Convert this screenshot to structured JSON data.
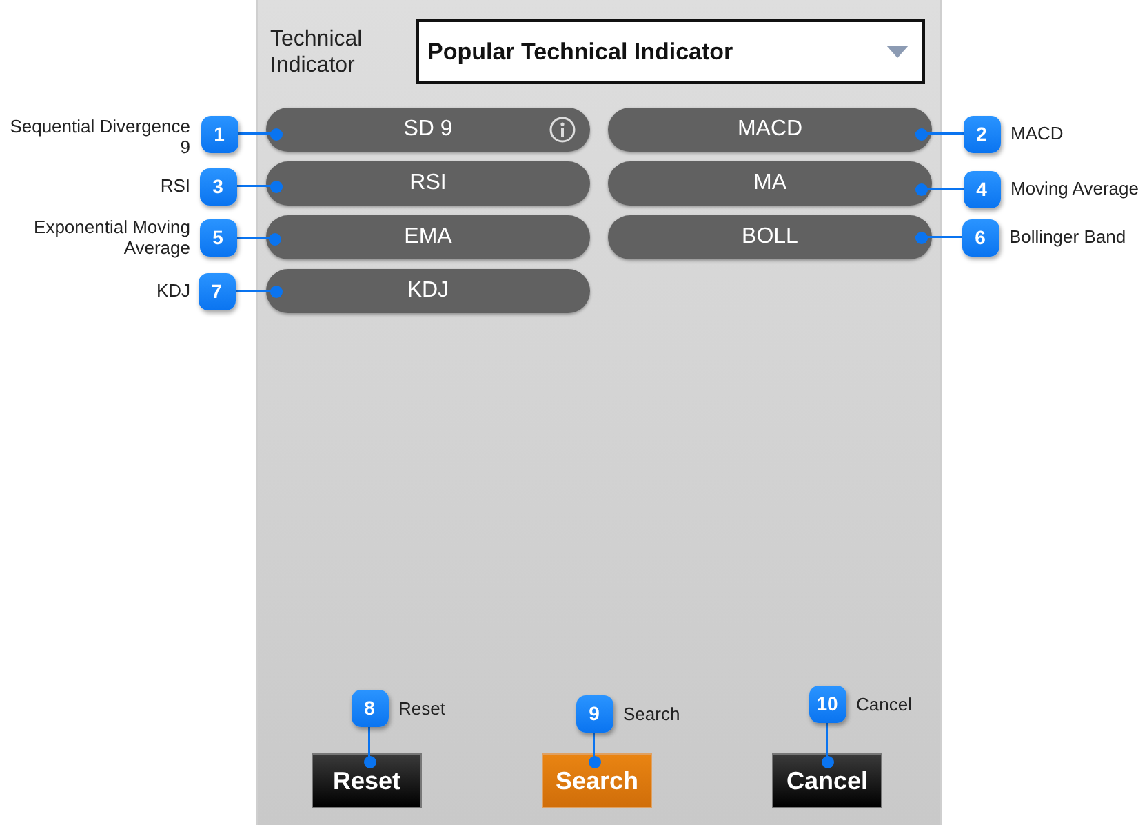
{
  "filter": {
    "label": "Technical Indicator",
    "dropdown": {
      "value": "Popular Technical Indicator"
    }
  },
  "indicators": [
    {
      "label": "SD 9",
      "info": true
    },
    {
      "label": "MACD",
      "info": false
    },
    {
      "label": "RSI",
      "info": false
    },
    {
      "label": "MA",
      "info": false
    },
    {
      "label": "EMA",
      "info": false
    },
    {
      "label": "BOLL",
      "info": false
    },
    {
      "label": "KDJ",
      "info": false
    }
  ],
  "actions": [
    {
      "label": "Reset",
      "kind": "secondary"
    },
    {
      "label": "Search",
      "kind": "primary"
    },
    {
      "label": "Cancel",
      "kind": "secondary"
    }
  ],
  "callouts": [
    {
      "number": "1",
      "text": "Sequential Divergence 9"
    },
    {
      "number": "2",
      "text": "MACD"
    },
    {
      "number": "3",
      "text": "RSI"
    },
    {
      "number": "4",
      "text": "Moving Average"
    },
    {
      "number": "5",
      "text": "Exponential Moving Average"
    },
    {
      "number": "6",
      "text": "Bollinger Band"
    },
    {
      "number": "7",
      "text": "KDJ"
    },
    {
      "number": "8",
      "text": "Reset"
    },
    {
      "number": "9",
      "text": "Search"
    },
    {
      "number": "10",
      "text": "Cancel"
    }
  ]
}
